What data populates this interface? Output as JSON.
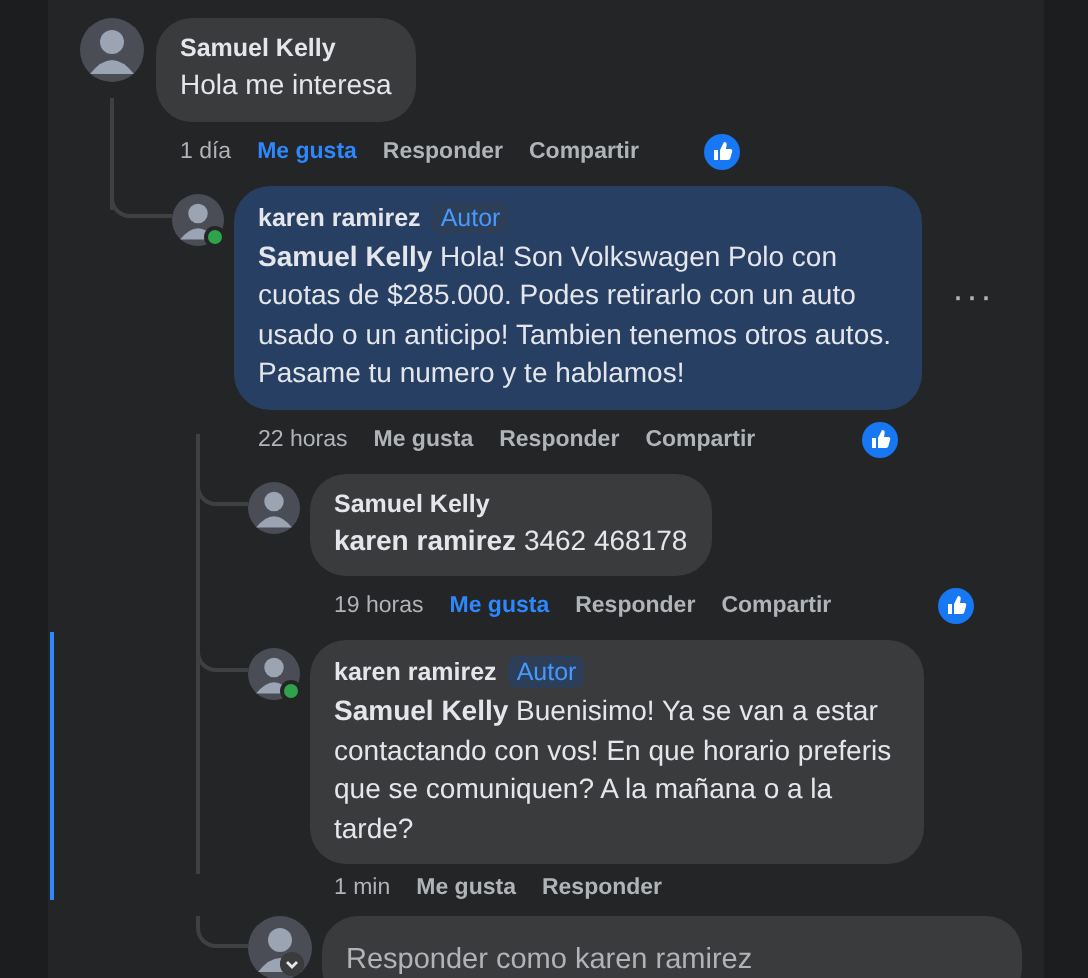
{
  "comments": [
    {
      "author": "Samuel Kelly",
      "highlighted": false,
      "text": "Hola me interesa",
      "time": "1 día",
      "like": {
        "label": "Me gusta",
        "selected": true
      },
      "actions": [
        "Responder",
        "Compartir"
      ],
      "reaction": true,
      "children": [
        {
          "author": "karen ramirez",
          "online": true,
          "badge": "Autor",
          "highlighted": true,
          "text": "**Samuel Kelly** Hola! Son Volkswagen Polo con cuotas de $285.000. Podes retirarlo con un auto usado o un anticipo! Tambien tenemos otros autos. Pasame tu numero y te hablamos!",
          "time": "22 horas",
          "like": {
            "label": "Me gusta",
            "selected": false
          },
          "actions": [
            "Responder",
            "Compartir"
          ],
          "reaction": true,
          "more": "···",
          "children": [
            {
              "author": "Samuel Kelly",
              "highlighted": false,
              "text": "**karen ramirez** 3462 468178",
              "time": "19 horas",
              "like": {
                "label": "Me gusta",
                "selected": true
              },
              "actions": [
                "Responder",
                "Compartir"
              ],
              "reaction": true
            },
            {
              "author": "karen ramirez",
              "online": true,
              "badge": "Autor",
              "highlighted": false,
              "new": true,
              "text": "**Samuel Kelly** Buenisimo! Ya se van a estar contactando con vos! En que horario preferis que se comuniquen? A la mañana o a la tarde?",
              "time": "1 min",
              "like": {
                "label": "Me gusta",
                "selected": false
              },
              "actions": [
                "Responder"
              ]
            }
          ],
          "reply_box": {
            "placeholder": "Responder como karen ramirez"
          }
        }
      ]
    }
  ]
}
